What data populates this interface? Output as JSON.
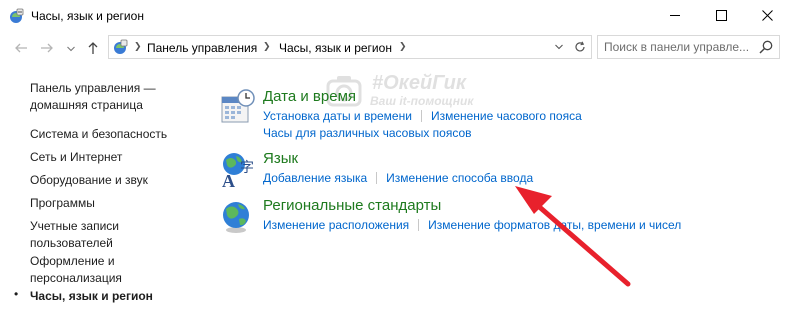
{
  "window": {
    "title": "Часы, язык и регион",
    "controls": {
      "minimize": "minimize-icon",
      "maximize": "maximize-icon",
      "close": "close-icon"
    }
  },
  "address_bar": {
    "breadcrumbs": [
      "Панель управления",
      "Часы, язык и регион"
    ],
    "search_placeholder": "Поиск в панели управле..."
  },
  "sidebar": {
    "items": [
      {
        "label": "Панель управления — домашняя страница",
        "current": false
      },
      {
        "label": "Система и безопасность",
        "current": false
      },
      {
        "label": "Сеть и Интернет",
        "current": false
      },
      {
        "label": "Оборудование и звук",
        "current": false
      },
      {
        "label": "Программы",
        "current": false
      },
      {
        "label": "Учетные записи пользователей",
        "current": false
      },
      {
        "label": "Оформление и персонализация",
        "current": false
      },
      {
        "label": "Часы, язык и регион",
        "current": true
      }
    ]
  },
  "categories": [
    {
      "title": "Дата и время",
      "icon": "calendar-clock-icon",
      "links": [
        "Установка даты и времени",
        "Изменение часового пояса"
      ],
      "links_row2": [
        "Часы для различных часовых поясов"
      ]
    },
    {
      "title": "Язык",
      "icon": "language-globe-icon",
      "links": [
        "Добавление языка",
        "Изменение способа ввода"
      ]
    },
    {
      "title": "Региональные стандарты",
      "icon": "globe-icon",
      "links": [
        "Изменение расположения",
        "Изменение форматов даты, времени и чисел"
      ]
    }
  ],
  "watermark": {
    "title": "#ОкейГик",
    "subtitle": "Ваш it-помощник"
  },
  "colors": {
    "link": "#0066cc",
    "category_title": "#1e7a1e",
    "arrow": "#e8212c"
  }
}
